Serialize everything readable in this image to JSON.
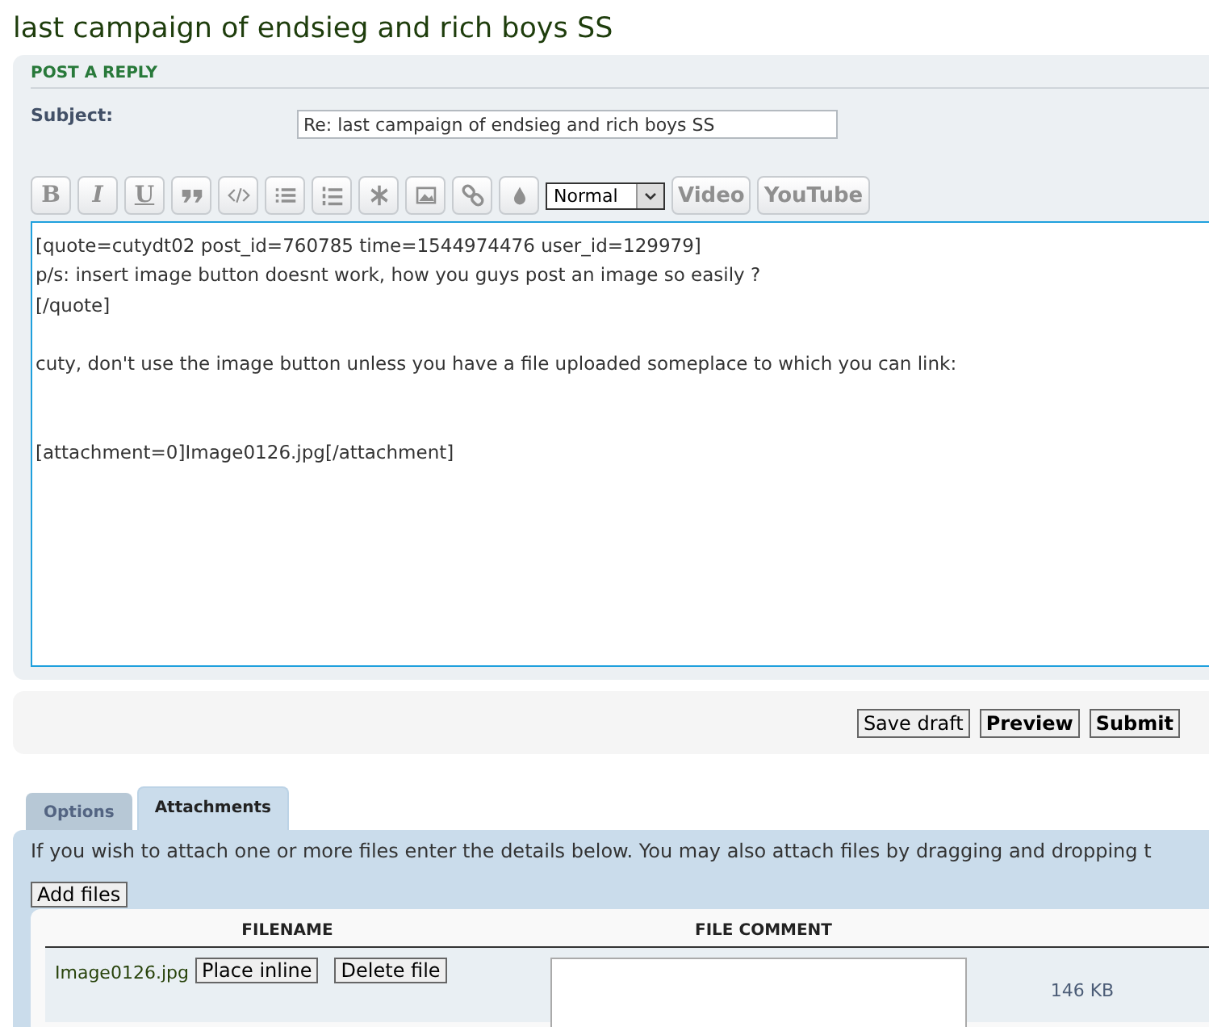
{
  "title": "last campaign of endsieg and rich boys SS",
  "panel_heading": "POST A REPLY",
  "subject": {
    "label": "Subject:",
    "value": "Re: last campaign of endsieg and rich boys SS"
  },
  "toolbar": [
    {
      "kind": "letter",
      "label": "B"
    },
    {
      "kind": "letter",
      "label": "I"
    },
    {
      "kind": "letter",
      "label": "U"
    },
    {
      "kind": "icon"
    },
    {
      "kind": "icon"
    },
    {
      "kind": "icon"
    },
    {
      "kind": "icon"
    },
    {
      "kind": "icon"
    },
    {
      "kind": "icon"
    },
    {
      "kind": "icon"
    },
    {
      "kind": "icon"
    },
    {
      "kind": "select",
      "value": "Normal"
    },
    {
      "kind": "text",
      "label": "Video"
    },
    {
      "kind": "text",
      "label": "YouTube"
    }
  ],
  "message": "[quote=cutydt02 post_id=760785 time=1544974476 user_id=129979]\np/s: insert image button doesnt work, how you guys post an image so easily ?\n[/quote]\n\ncuty, don't use the image button unless you have a file uploaded someplace to which you can link:\n\n\n[attachment=0]Image0126.jpg[/attachment]",
  "actions": [
    {
      "label": "Save draft",
      "primary": false
    },
    {
      "label": "Preview",
      "primary": true
    },
    {
      "label": "Submit",
      "primary": true
    }
  ],
  "tabs": [
    {
      "label": "Options",
      "selected": false
    },
    {
      "label": "Attachments",
      "selected": true
    }
  ],
  "attach_info": "If you wish to attach one or more files enter the details below. You may also attach files by dragging and dropping t",
  "add_files": "Add files",
  "columns": [
    "FILENAME",
    "FILE COMMENT"
  ],
  "files": [
    {
      "name": "Image0126.jpg",
      "buttons": [
        "Place inline",
        "Delete file"
      ],
      "size": "146 KB"
    }
  ]
}
